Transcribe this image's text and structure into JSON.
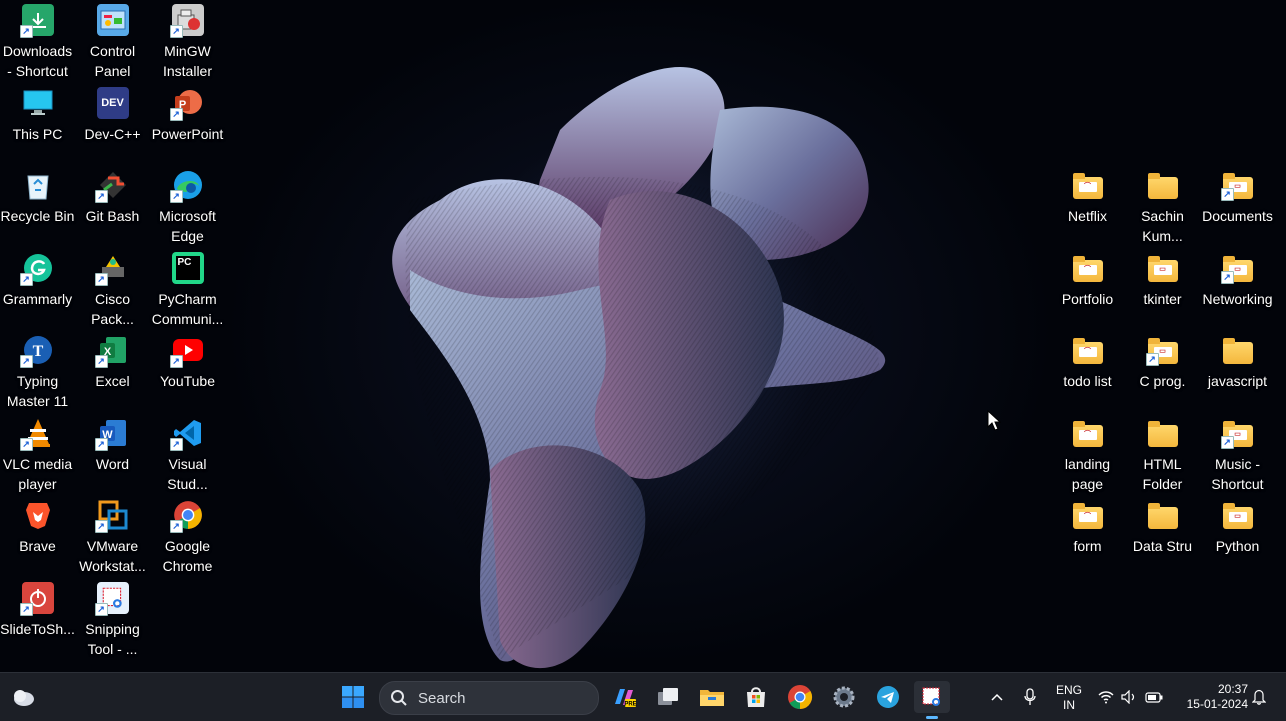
{
  "desktop": {
    "left_icons": [
      {
        "label": "Downloads - Shortcut",
        "icon": "downloads-folder-icon"
      },
      {
        "label": "Control Panel",
        "icon": "control-panel-icon"
      },
      {
        "label": "MinGW Installer",
        "icon": "mingw-installer-icon"
      },
      {
        "label": "This PC",
        "icon": "monitor-icon"
      },
      {
        "label": "Dev-C++",
        "icon": "devcpp-icon"
      },
      {
        "label": "PowerPoint",
        "icon": "powerpoint-icon"
      },
      {
        "label": "Recycle Bin",
        "icon": "recycle-bin-icon"
      },
      {
        "label": "Git Bash",
        "icon": "git-bash-icon"
      },
      {
        "label": "Microsoft Edge",
        "icon": "edge-icon"
      },
      {
        "label": "Grammarly",
        "icon": "grammarly-icon"
      },
      {
        "label": "Cisco Pack...",
        "icon": "cisco-packet-tracer-icon"
      },
      {
        "label": "PyCharm Communi...",
        "icon": "pycharm-icon"
      },
      {
        "label": "Typing Master 11",
        "icon": "typing-master-icon"
      },
      {
        "label": "Excel",
        "icon": "excel-icon"
      },
      {
        "label": "YouTube",
        "icon": "youtube-icon"
      },
      {
        "label": "VLC media player",
        "icon": "vlc-icon"
      },
      {
        "label": "Word",
        "icon": "word-icon"
      },
      {
        "label": "Visual Stud...",
        "icon": "vscode-icon"
      },
      {
        "label": "Brave",
        "icon": "brave-icon"
      },
      {
        "label": "VMware Workstat...",
        "icon": "vmware-icon"
      },
      {
        "label": "Google Chrome",
        "icon": "chrome-icon"
      },
      {
        "label": "SlideToSh...",
        "icon": "slidetoshutdown-icon"
      },
      {
        "label": "Snipping Tool - ...",
        "icon": "snipping-tool-icon"
      }
    ],
    "right_icons": [
      {
        "label": "Netflix",
        "icon": "folder-icon"
      },
      {
        "label": "Sachin Kum...",
        "icon": "folder-icon"
      },
      {
        "label": "Documents",
        "icon": "folder-icon"
      },
      {
        "label": "Portfolio",
        "icon": "folder-icon"
      },
      {
        "label": "tkinter",
        "icon": "folder-icon"
      },
      {
        "label": "Networking",
        "icon": "folder-icon"
      },
      {
        "label": "todo list",
        "icon": "folder-icon"
      },
      {
        "label": "C prog.",
        "icon": "folder-icon"
      },
      {
        "label": "javascript",
        "icon": "folder-icon"
      },
      {
        "label": "landing page",
        "icon": "folder-icon"
      },
      {
        "label": "HTML Folder",
        "icon": "folder-icon"
      },
      {
        "label": "Music - Shortcut",
        "icon": "folder-icon"
      },
      {
        "label": "form",
        "icon": "folder-icon"
      },
      {
        "label": "Data Stru",
        "icon": "folder-icon"
      },
      {
        "label": "Python",
        "icon": "folder-icon"
      }
    ]
  },
  "taskbar": {
    "search_label": "Search",
    "apps": [
      "weather-icon",
      "start-icon",
      "copilot-icon",
      "task-view-icon",
      "file-explorer-icon",
      "microsoft-store-icon",
      "chrome-icon",
      "settings-icon",
      "telegram-icon",
      "snipping-tool-icon"
    ],
    "tray": {
      "lang_line1": "ENG",
      "lang_line2": "IN",
      "time": "20:37",
      "date": "15-01-2024"
    }
  },
  "colors": {
    "taskbar_bg": "#1c1f26",
    "folder_yellow": "#f4b73d",
    "accent_blue": "#1a73e8"
  }
}
